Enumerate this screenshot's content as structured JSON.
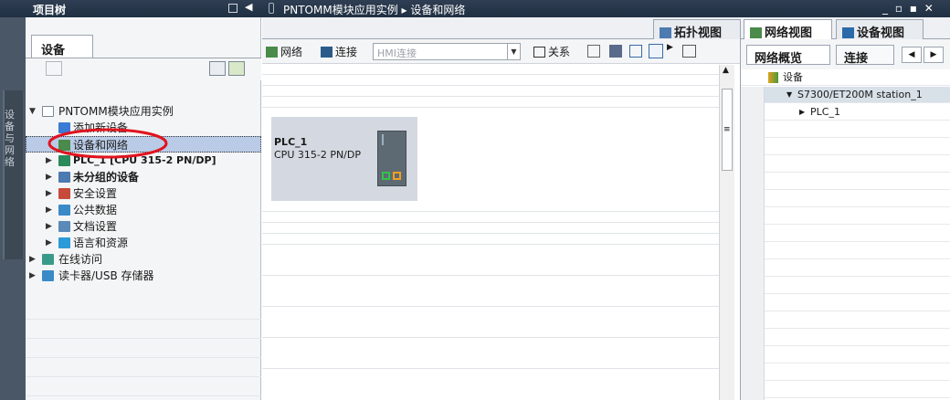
{
  "title_bar": {
    "project_tree_title": "项目树",
    "breadcrumb": "PNTOMM模块应用实例 ▸ 设备和网络",
    "window_controls": "_ ▫ ▪ ✕"
  },
  "vertical_tab": {
    "label": "设备与网络"
  },
  "left_panel": {
    "tab_label": "设备",
    "tree": [
      {
        "label": "PNTOMM模块应用实例",
        "level": 0,
        "expanded": true,
        "icon": "project-icon"
      },
      {
        "label": "添加新设备",
        "level": 1,
        "icon": "add-device-icon"
      },
      {
        "label": "设备和网络",
        "level": 1,
        "icon": "network-icon",
        "selected": true
      },
      {
        "label": "PLC_1 [CPU 315-2 PN/DP]",
        "level": 1,
        "expandable": true,
        "icon": "plc-icon"
      },
      {
        "label": "未分组的设备",
        "level": 1,
        "expandable": true,
        "icon": "ungrouped-devices-icon"
      },
      {
        "label": "安全设置",
        "level": 1,
        "expandable": true,
        "icon": "security-icon"
      },
      {
        "label": "公共数据",
        "level": 1,
        "expandable": true,
        "icon": "common-data-icon"
      },
      {
        "label": "文档设置",
        "level": 1,
        "expandable": true,
        "icon": "document-icon"
      },
      {
        "label": "语言和资源",
        "level": 1,
        "expandable": true,
        "icon": "language-icon"
      },
      {
        "label": "在线访问",
        "level": 0,
        "expandable": true,
        "icon": "online-access-icon"
      },
      {
        "label": "读卡器/USB 存储器",
        "level": 0,
        "expandable": true,
        "icon": "card-reader-icon"
      }
    ]
  },
  "view_tabs": {
    "topology": "拓扑视图",
    "network": "网络视图",
    "device": "设备视图"
  },
  "network_toolbar": {
    "network": "网络",
    "connection": "连接",
    "hmi_connection": "HMI连接",
    "relation": "关系"
  },
  "canvas": {
    "plc_name": "PLC_1",
    "plc_type": "CPU 315-2 PN/DP"
  },
  "overview": {
    "tab_overview": "网络概览",
    "tab_connection": "连接",
    "rows": [
      {
        "label": "设备",
        "level": 0
      },
      {
        "label": "S7300/ET200M station_1",
        "level": 1
      },
      {
        "label": "PLC_1",
        "level": 2
      }
    ]
  },
  "colors": {
    "title_bar": "#203043",
    "selection": "#b9cbe6",
    "highlight_circle": "#e0141e",
    "plc_box": "#d4d8e0"
  }
}
